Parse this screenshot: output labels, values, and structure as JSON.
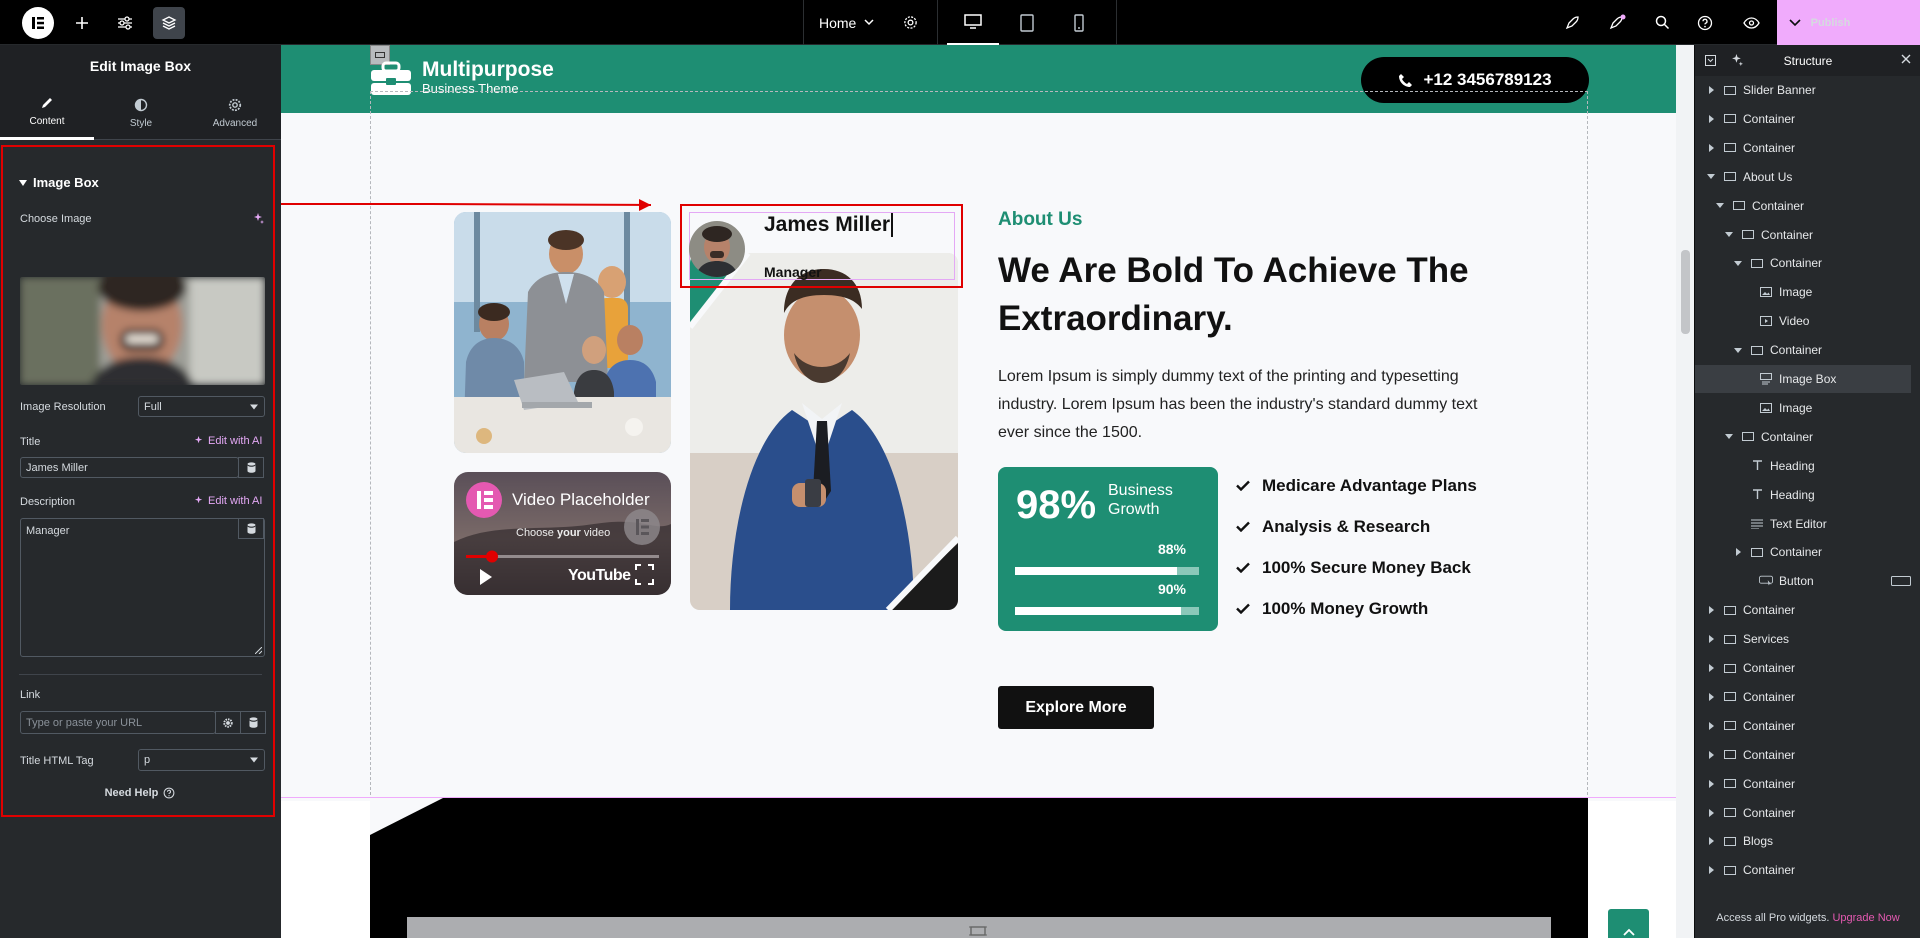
{
  "topbar": {
    "page_name": "Home",
    "publish_label": "Publish"
  },
  "panel": {
    "title": "Edit Image Box",
    "tabs": [
      {
        "label": "Content"
      },
      {
        "label": "Style"
      },
      {
        "label": "Advanced"
      }
    ],
    "section_title": "Image Box",
    "choose_image_label": "Choose Image",
    "resolution_label": "Image Resolution",
    "resolution_value": "Full",
    "title_label": "Title",
    "title_value": "James Miller",
    "edit_ai_label": "Edit with AI",
    "description_label": "Description",
    "description_value": "Manager",
    "link_label": "Link",
    "link_placeholder": "Type or paste your URL",
    "tag_label": "Title HTML Tag",
    "tag_value": "p",
    "need_help": "Need Help"
  },
  "site": {
    "brand_line1": "Multipurpose",
    "brand_line2": "Business Theme",
    "phone": "+12 3456789123",
    "video_title": "Video Placeholder",
    "video_sub_pre": "Choose ",
    "video_sub_bold": "your",
    "video_sub_post": " video",
    "youtube": "YouTube",
    "imagebox_title": "James Miller",
    "imagebox_desc": "Manager",
    "kicker": "About Us",
    "heading": "We Are Bold To Achieve The Extraordinary.",
    "body": "Lorem Ipsum is simply dummy text of the printing and typesetting industry. Lorem Ipsum has been the industry's standard dummy text ever since the 1500.",
    "stat_value": "98%",
    "stat_label": "Business Growth",
    "bars": [
      {
        "value": "88%",
        "fill": 0.88
      },
      {
        "value": "90%",
        "fill": 0.9
      }
    ],
    "checklist": [
      "Medicare Advantage Plans",
      "Analysis & Research",
      "100% Secure Money Back",
      "100% Money Growth"
    ],
    "cta": "Explore More",
    "accent": "#1e8e73"
  },
  "structure": {
    "title": "Structure",
    "items": [
      {
        "label": "Slider Banner",
        "icon": "container-icon",
        "expand": "closed"
      },
      {
        "label": "Container",
        "icon": "container-icon",
        "expand": "closed"
      },
      {
        "label": "Container",
        "icon": "container-icon",
        "expand": "closed"
      },
      {
        "label": "About Us",
        "icon": "container-icon",
        "expand": "open"
      },
      {
        "label": "Container",
        "icon": "container-icon",
        "expand": "open"
      },
      {
        "label": "Container",
        "icon": "container-icon",
        "expand": "open"
      },
      {
        "label": "Container",
        "icon": "container-icon",
        "expand": "open"
      },
      {
        "label": "Image",
        "icon": "image-icon",
        "expand": "none"
      },
      {
        "label": "Video",
        "icon": "video-icon",
        "expand": "none"
      },
      {
        "label": "Container",
        "icon": "container-icon",
        "expand": "open"
      },
      {
        "label": "Image Box",
        "icon": "image-box-icon",
        "expand": "none"
      },
      {
        "label": "Image",
        "icon": "image-icon",
        "expand": "none"
      },
      {
        "label": "Container",
        "icon": "container-icon",
        "expand": "open"
      },
      {
        "label": "Heading",
        "icon": "heading-icon",
        "expand": "none"
      },
      {
        "label": "Heading",
        "icon": "heading-icon",
        "expand": "none"
      },
      {
        "label": "Text Editor",
        "icon": "text-editor-icon",
        "expand": "none"
      },
      {
        "label": "Container",
        "icon": "container-icon",
        "expand": "closed"
      },
      {
        "label": "Button",
        "icon": "button-icon",
        "expand": "none"
      },
      {
        "label": "Container",
        "icon": "container-icon",
        "expand": "closed"
      },
      {
        "label": "Services",
        "icon": "container-icon",
        "expand": "closed"
      },
      {
        "label": "Container",
        "icon": "container-icon",
        "expand": "closed"
      },
      {
        "label": "Container",
        "icon": "container-icon",
        "expand": "closed"
      },
      {
        "label": "Container",
        "icon": "container-icon",
        "expand": "closed"
      },
      {
        "label": "Container",
        "icon": "container-icon",
        "expand": "closed"
      },
      {
        "label": "Container",
        "icon": "container-icon",
        "expand": "closed"
      },
      {
        "label": "Container",
        "icon": "container-icon",
        "expand": "closed"
      },
      {
        "label": "Blogs",
        "icon": "container-icon",
        "expand": "closed"
      },
      {
        "label": "Container",
        "icon": "container-icon",
        "expand": "closed"
      }
    ],
    "footer_text": "Access all Pro widgets.",
    "footer_link": "Upgrade Now"
  }
}
